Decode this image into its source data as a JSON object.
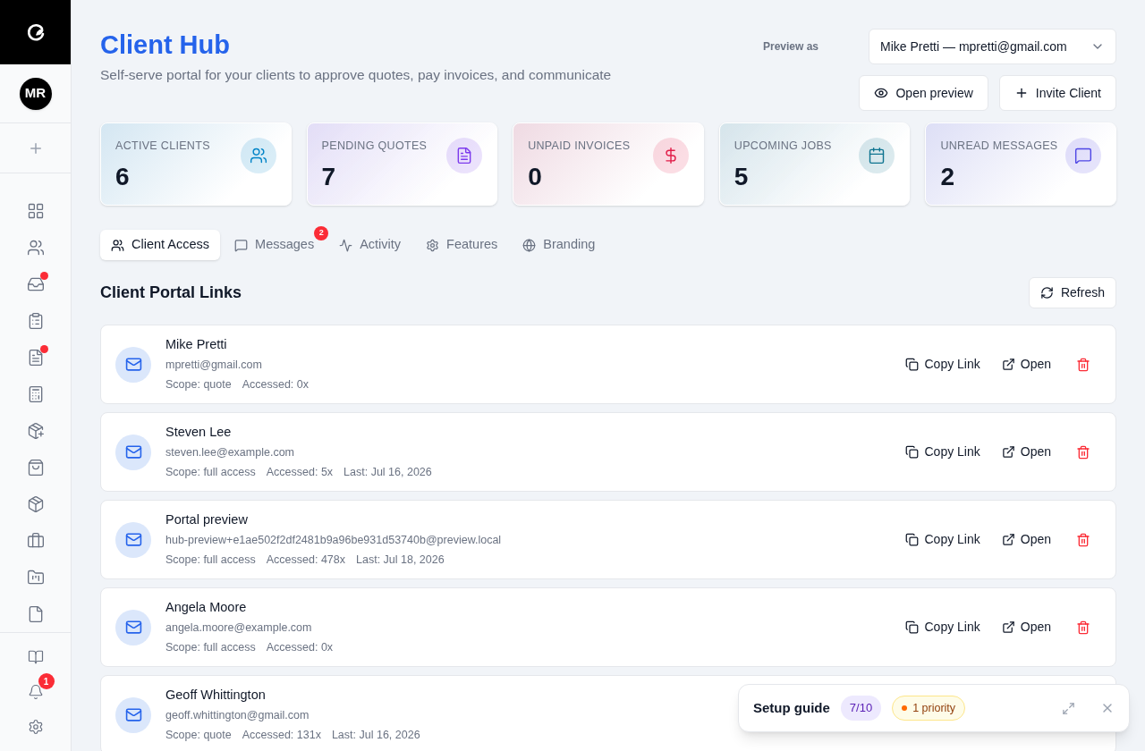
{
  "sidebar": {
    "avatar": "MR",
    "nav": [
      {
        "unread": false
      },
      {
        "unread": false
      },
      {
        "unread": true
      },
      {
        "unread": false
      },
      {
        "unread": true
      },
      {
        "unread": false
      },
      {
        "unread": false
      },
      {
        "unread": false
      },
      {
        "unread": false
      },
      {
        "unread": false
      },
      {
        "unread": false
      },
      {
        "unread": false
      }
    ],
    "notifications_badge": "1"
  },
  "header": {
    "title": "Client Hub",
    "subtitle": "Self-serve portal for your clients to approve quotes, pay invoices, and communicate",
    "preview_label": "Preview as",
    "preview_value": "Mike Pretti — mpretti@gmail.com",
    "buttons": [
      "Open preview",
      "Invite Client"
    ]
  },
  "stats": [
    {
      "label": "ACTIVE CLIENTS",
      "value": "6",
      "color": "#0284c7"
    },
    {
      "label": "PENDING QUOTES",
      "value": "7",
      "color": "#7c3aed"
    },
    {
      "label": "UNPAID INVOICES",
      "value": "0",
      "color": "#e11d48"
    },
    {
      "label": "UPCOMING JOBS",
      "value": "5",
      "color": "#0e7490"
    },
    {
      "label": "UNREAD MESSAGES",
      "value": "2",
      "color": "#4f46e5"
    }
  ],
  "tabs": [
    {
      "label": "Client Access",
      "selected": true
    },
    {
      "label": "Messages",
      "selected": false,
      "badge": "2"
    },
    {
      "label": "Activity",
      "selected": false
    },
    {
      "label": "Features",
      "selected": false
    },
    {
      "label": "Branding",
      "selected": false
    }
  ],
  "section": {
    "title": "Client Portal Links",
    "refresh": "Refresh"
  },
  "links": [
    {
      "name": "Mike Pretti",
      "email": "mpretti@gmail.com",
      "meta": [
        "Scope: quote",
        "Accessed: 0x"
      ],
      "actions": [
        "Copy Link",
        "Open"
      ]
    },
    {
      "name": "Steven Lee",
      "email": "steven.lee@example.com",
      "meta": [
        "Scope: full access",
        "Accessed: 5x",
        "Last: Jul 16, 2026"
      ],
      "actions": [
        "Copy Link",
        "Open"
      ]
    },
    {
      "name": "Portal preview",
      "email": "hub-preview+e1ae502f2df2481b9a96be931d53740b@preview.local",
      "meta": [
        "Scope: full access",
        "Accessed: 478x",
        "Last: Jul 18, 2026"
      ],
      "actions": [
        "Copy Link",
        "Open"
      ]
    },
    {
      "name": "Angela Moore",
      "email": "angela.moore@example.com",
      "meta": [
        "Scope: full access",
        "Accessed: 0x"
      ],
      "actions": [
        "Copy Link",
        "Open"
      ]
    },
    {
      "name": "Geoff Whittington",
      "email": "geoff.whittington@gmail.com",
      "meta": [
        "Scope: quote",
        "Accessed: 131x",
        "Last: Jul 16, 2026"
      ]
    }
  ],
  "setup_guide": {
    "title": "Setup guide",
    "progress": "7/10",
    "priority": "1 priority"
  }
}
